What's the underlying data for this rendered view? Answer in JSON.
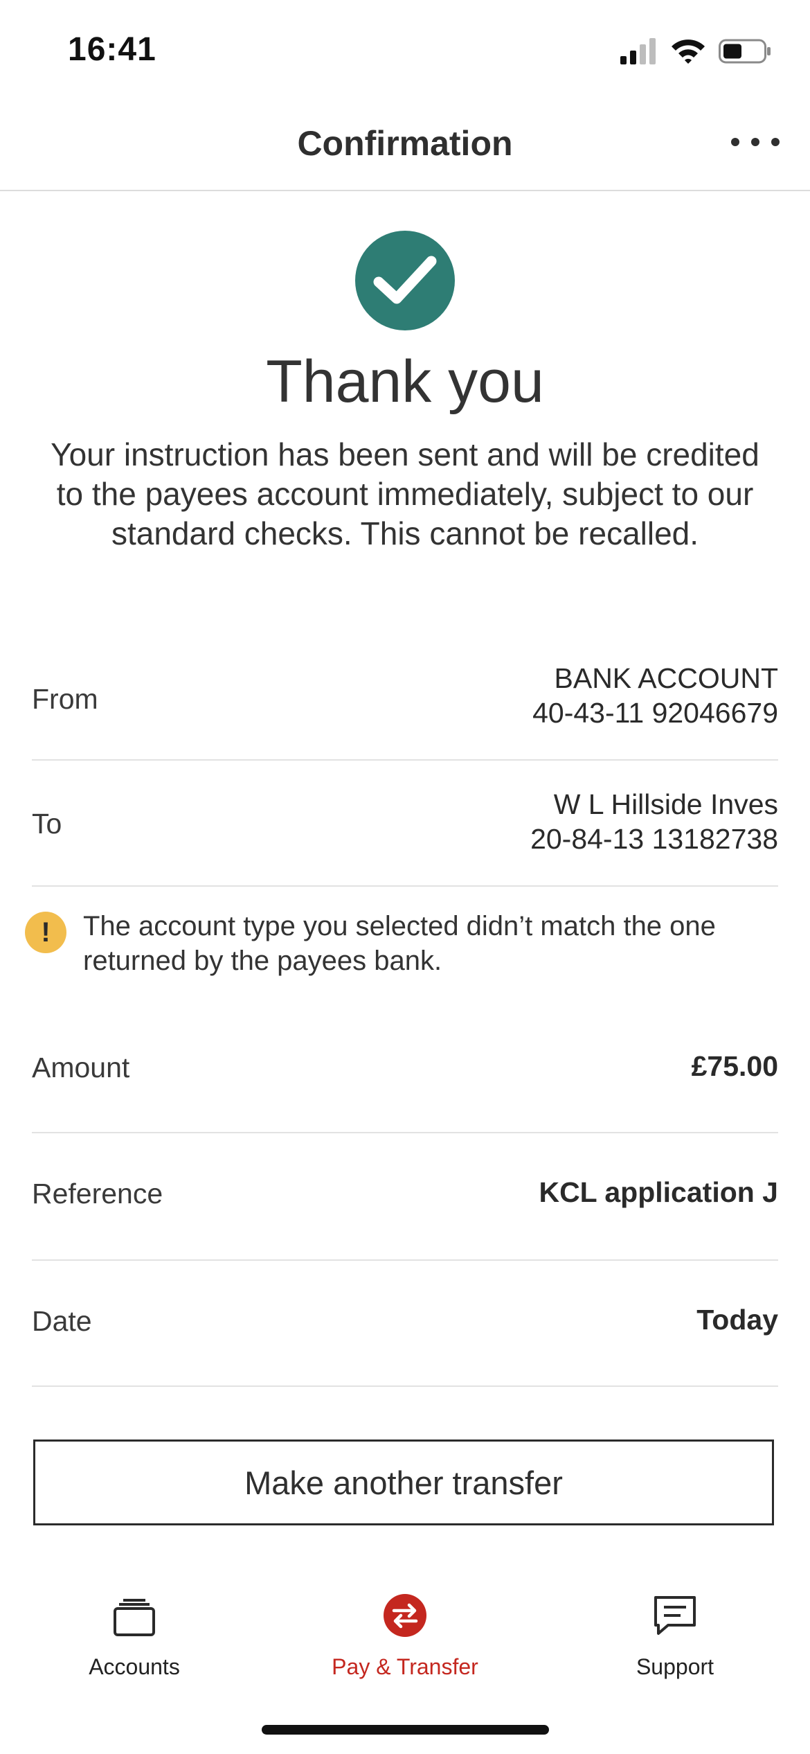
{
  "status_bar": {
    "time": "16:41"
  },
  "header": {
    "title": "Confirmation"
  },
  "confirmation": {
    "title": "Thank you",
    "message": "Your instruction has been sent and will be credited to the payees account immediately, subject to our standard checks.  This cannot be recalled."
  },
  "details": {
    "from": {
      "label": "From",
      "line1": "BANK ACCOUNT",
      "line2": "40-43-11 92046679"
    },
    "to": {
      "label": "To",
      "line1": "W L Hillside Inves",
      "line2": "20-84-13 13182738"
    },
    "warning": {
      "icon": "!",
      "text": "The account type you selected didn’t match the one returned by the payees bank."
    },
    "amount": {
      "label": "Amount",
      "value": "£75.00"
    },
    "reference": {
      "label": "Reference",
      "value": "KCL application J"
    },
    "date": {
      "label": "Date",
      "value": "Today"
    }
  },
  "actions": {
    "another_transfer": "Make another transfer"
  },
  "tab_bar": {
    "items": [
      {
        "label": "Accounts",
        "icon": "wallet-icon"
      },
      {
        "label": "Pay & Transfer",
        "icon": "transfer-icon",
        "active": true
      },
      {
        "label": "Support",
        "icon": "chat-icon"
      }
    ]
  },
  "colors": {
    "success": "#2e7d74",
    "warning": "#f2bd4d",
    "accent": "#c4271f"
  }
}
